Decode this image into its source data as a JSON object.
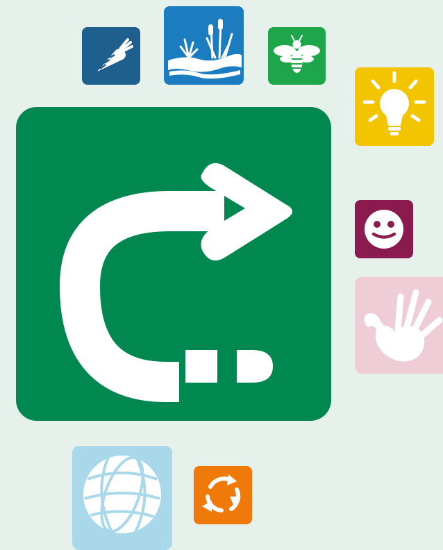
{
  "colors": {
    "background": "#e6f1ec",
    "carrot_tile": "#1e5f8d",
    "wetland_tile": "#1b7cc0",
    "bee_tile": "#1da64a",
    "bulb_tile": "#f2c500",
    "main_tile": "#008850",
    "smiley_tile": "#8b1a4f",
    "hand_tile": "#efcdd6",
    "globe_tile": "#a8d8ea",
    "cycle_tile": "#ef7a09"
  },
  "icons": [
    "carrot-icon",
    "wetland-icon",
    "bee-icon",
    "lightbulb-icon",
    "redo-arrow-icon",
    "smiley-icon",
    "handprint-icon",
    "globe-icon",
    "recycle-icon"
  ]
}
